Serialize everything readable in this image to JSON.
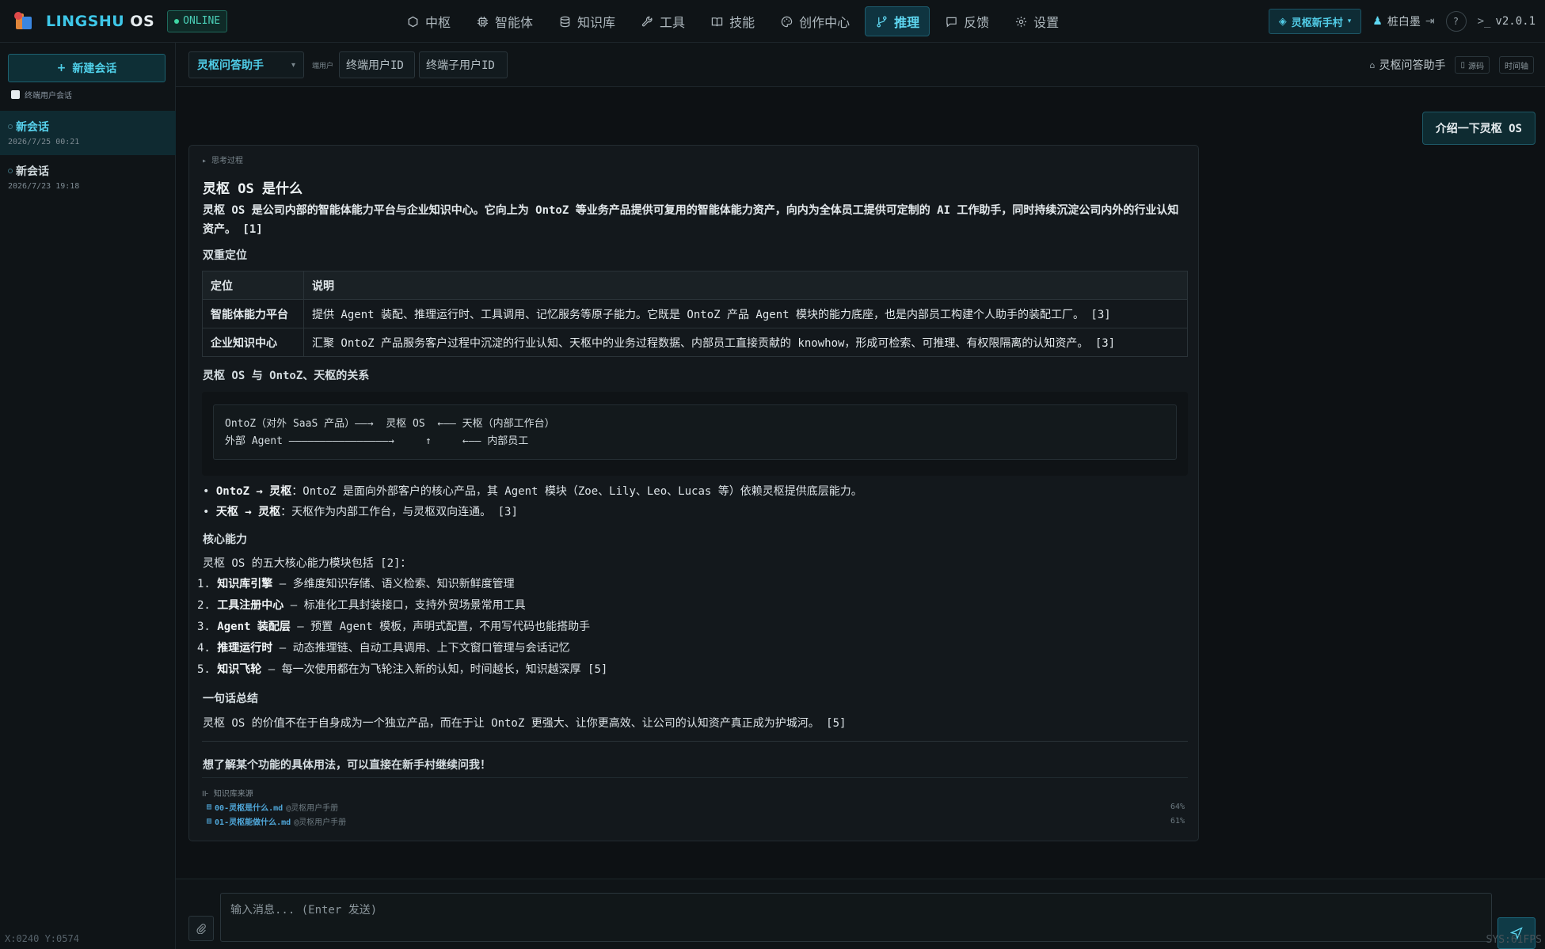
{
  "brand": {
    "name_a": "LINGSHU",
    "name_b": " OS",
    "status": "ONLINE"
  },
  "nav": [
    {
      "label": "中枢",
      "icon": "hexagon-icon"
    },
    {
      "label": "智能体",
      "icon": "cpu-icon"
    },
    {
      "label": "知识库",
      "icon": "database-icon"
    },
    {
      "label": "工具",
      "icon": "wrench-icon"
    },
    {
      "label": "技能",
      "icon": "book-icon"
    },
    {
      "label": "创作中心",
      "icon": "palette-icon"
    },
    {
      "label": "推理",
      "icon": "branch-icon",
      "active": true
    },
    {
      "label": "反馈",
      "icon": "message-icon"
    },
    {
      "label": "设置",
      "icon": "gear-icon"
    }
  ],
  "topright": {
    "village": "灵枢新手村",
    "user": "桩白墨",
    "version": "v2.0.1"
  },
  "sidebar": {
    "new_chat": "新建会话",
    "checkbox_label": "终端用户会话",
    "sessions": [
      {
        "title": "新会话",
        "time": "2026/7/25 00:21",
        "active": true
      },
      {
        "title": "新会话",
        "time": "2026/7/23 19:18",
        "active": false
      }
    ],
    "coords": "X:0240 Y:0574"
  },
  "header": {
    "assistant": "灵枢问答助手",
    "tiny_label": "端用户",
    "end_user_id": "终端用户ID",
    "sub_user_id": "终端子用户ID",
    "right_name": "灵枢问答助手",
    "chip_source": "源码",
    "chip_timeline": "时间轴"
  },
  "chat": {
    "user_message": "介绍一下灵枢 OS",
    "think_label": "▸ 思考过程",
    "h1": "灵枢 OS 是什么",
    "intro": "灵枢 OS 是公司内部的智能体能力平台与企业知识中心。它向上为 OntoZ 等业务产品提供可复用的智能体能力资产，向内为全体员工提供可定制的 AI 工作助手，同时持续沉淀公司内外的行业认知资产。 [1]",
    "dual_title": "双重定位",
    "table": {
      "headers": [
        "定位",
        "说明"
      ],
      "rows": [
        [
          "智能体能力平台",
          "提供 Agent 装配、推理运行时、工具调用、记忆服务等原子能力。它既是 OntoZ 产品 Agent 模块的能力底座，也是内部员工构建个人助手的装配工厂。 [3]"
        ],
        [
          "企业知识中心",
          "汇聚 OntoZ 产品服务客户过程中沉淀的行业认知、天枢中的业务过程数据、内部员工直接贡献的 knowhow，形成可检索、可推理、有权限隔离的认知资产。 [3]"
        ]
      ]
    },
    "relation_title": "灵枢 OS 与 OntoZ、天枢的关系",
    "code": "OntoZ（对外 SaaS 产品）——→  灵枢 OS  ←—— 天枢（内部工作台）\n外部 Agent ————————————————→     ↑     ←—— 内部员工",
    "bullets": [
      {
        "bold": "OntoZ → 灵枢",
        "text": "：OntoZ 是面向外部客户的核心产品，其 Agent 模块（Zoe、Lily、Leo、Lucas 等）依赖灵枢提供底层能力。"
      },
      {
        "bold": "天枢 → 灵枢",
        "text": "：天枢作为内部工作台，与灵枢双向连通。 [3]"
      }
    ],
    "core_title": "核心能力",
    "core_intro": "灵枢 OS 的五大核心能力模块包括 [2]：",
    "caps": [
      {
        "n": "1.",
        "bold": "知识库引擎",
        "text": " — 多维度知识存储、语义检索、知识新鲜度管理"
      },
      {
        "n": "2.",
        "bold": "工具注册中心",
        "text": " — 标准化工具封装接口，支持外贸场景常用工具"
      },
      {
        "n": "3.",
        "bold": "Agent 装配层",
        "text": " — 预置 Agent 模板，声明式配置，不用写代码也能搭助手"
      },
      {
        "n": "4.",
        "bold": "推理运行时",
        "text": " — 动态推理链、自动工具调用、上下文窗口管理与会话记忆"
      },
      {
        "n": "5.",
        "bold": "知识飞轮",
        "text": " — 每一次使用都在为飞轮注入新的认知，时间越长，知识越深厚 [5]"
      }
    ],
    "summary_title": "一句话总结",
    "summary": "灵枢 OS 的价值不在于自身成为一个独立产品，而在于让 OntoZ 更强大、让你更高效、让公司的认知资产真正成为护城河。 [5]",
    "closing": "想了解某个功能的具体用法，可以直接在新手村继续问我！",
    "sources_title": "知识库来源",
    "sources": [
      {
        "file": "00-灵枢是什么.md",
        "from": "@灵枢用户手册",
        "pct": "64%"
      },
      {
        "file": "01-灵枢能做什么.md",
        "from": "@灵枢用户手册",
        "pct": "61%"
      }
    ]
  },
  "composer": {
    "placeholder": "输入消息... (Enter 发送)"
  },
  "footer": {
    "fps": "SYS:61FPS"
  },
  "colors": {
    "accent": "#3ec7e8",
    "bg": "#0d1114",
    "online": "#3fd6a4"
  }
}
